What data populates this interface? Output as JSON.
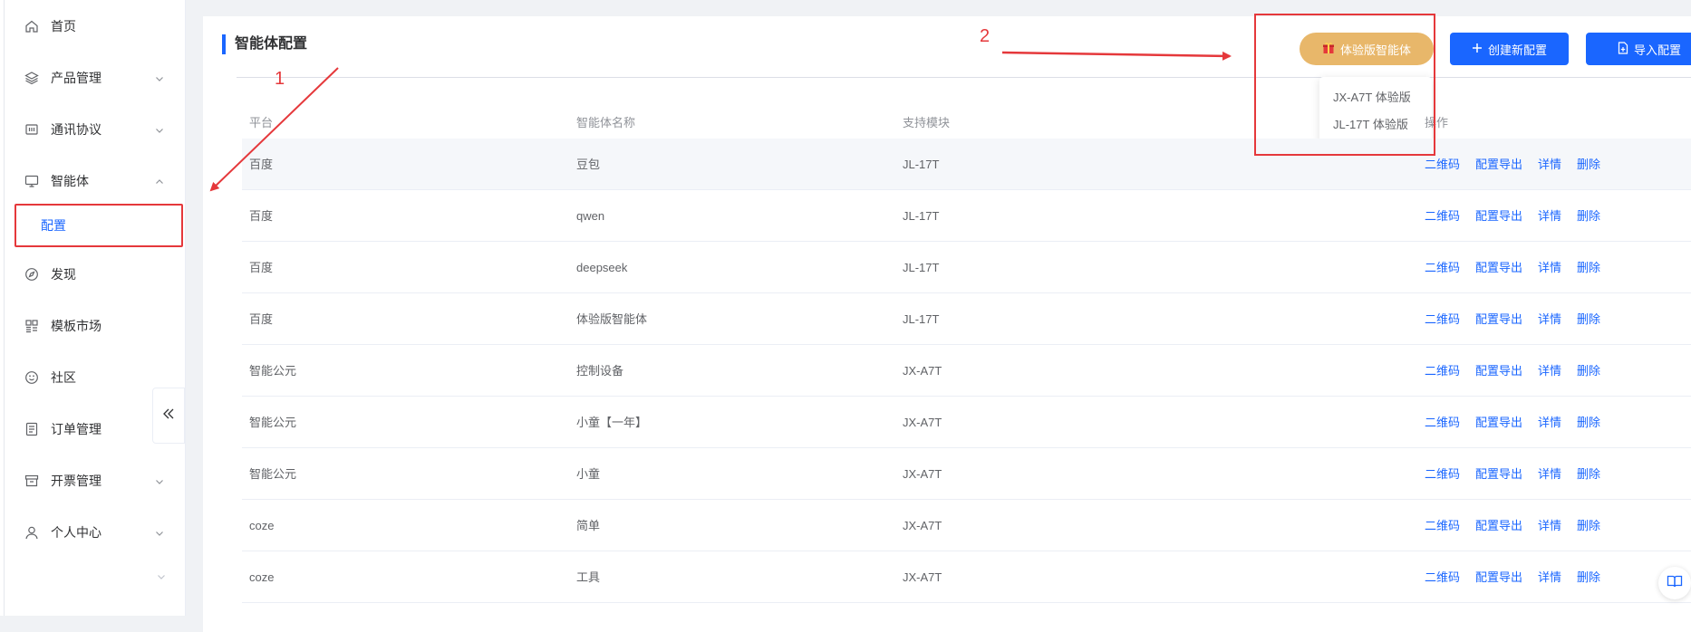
{
  "sidebar": {
    "items": [
      {
        "label": "首页",
        "icon": "home-icon"
      },
      {
        "label": "产品管理",
        "icon": "layers-icon"
      },
      {
        "label": "通讯协议",
        "icon": "protocol-icon"
      },
      {
        "label": "智能体",
        "icon": "monitor-icon"
      },
      {
        "label": "发现",
        "icon": "compass-icon"
      },
      {
        "label": "模板市场",
        "icon": "template-icon"
      },
      {
        "label": "社区",
        "icon": "smile-icon"
      },
      {
        "label": "订单管理",
        "icon": "order-icon"
      },
      {
        "label": "开票管理",
        "icon": "archive-icon"
      },
      {
        "label": "个人中心",
        "icon": "user-icon"
      }
    ],
    "sub_item": "配置"
  },
  "page": {
    "title": "智能体配置"
  },
  "toolbar": {
    "trial_label": "体验版智能体",
    "create_label": "创建新配置",
    "import_label": "导入配置"
  },
  "dropdown": {
    "items": [
      "JX-A7T 体验版",
      "JL-17T 体验版"
    ]
  },
  "table": {
    "headers": [
      "平台",
      "智能体名称",
      "支持模块",
      "操作"
    ],
    "rows": [
      {
        "platform": "百度",
        "name": "豆包",
        "module": "JL-17T"
      },
      {
        "platform": "百度",
        "name": "qwen",
        "module": "JL-17T"
      },
      {
        "platform": "百度",
        "name": "deepseek",
        "module": "JL-17T"
      },
      {
        "platform": "百度",
        "name": "体验版智能体",
        "module": "JL-17T"
      },
      {
        "platform": "智能公元",
        "name": "控制设备",
        "module": "JX-A7T"
      },
      {
        "platform": "智能公元",
        "name": "小童【一年】",
        "module": "JX-A7T"
      },
      {
        "platform": "智能公元",
        "name": "小童",
        "module": "JX-A7T"
      },
      {
        "platform": "coze",
        "name": "简单",
        "module": "JX-A7T"
      },
      {
        "platform": "coze",
        "name": "工具",
        "module": "JX-A7T"
      }
    ],
    "ops": [
      "二维码",
      "配置导出",
      "详情",
      "删除"
    ]
  },
  "annotations": {
    "one": "1",
    "two": "2"
  },
  "colors": {
    "primary": "#1a66ff",
    "trial": "#e8b76a",
    "annotation": "#e5383b"
  }
}
